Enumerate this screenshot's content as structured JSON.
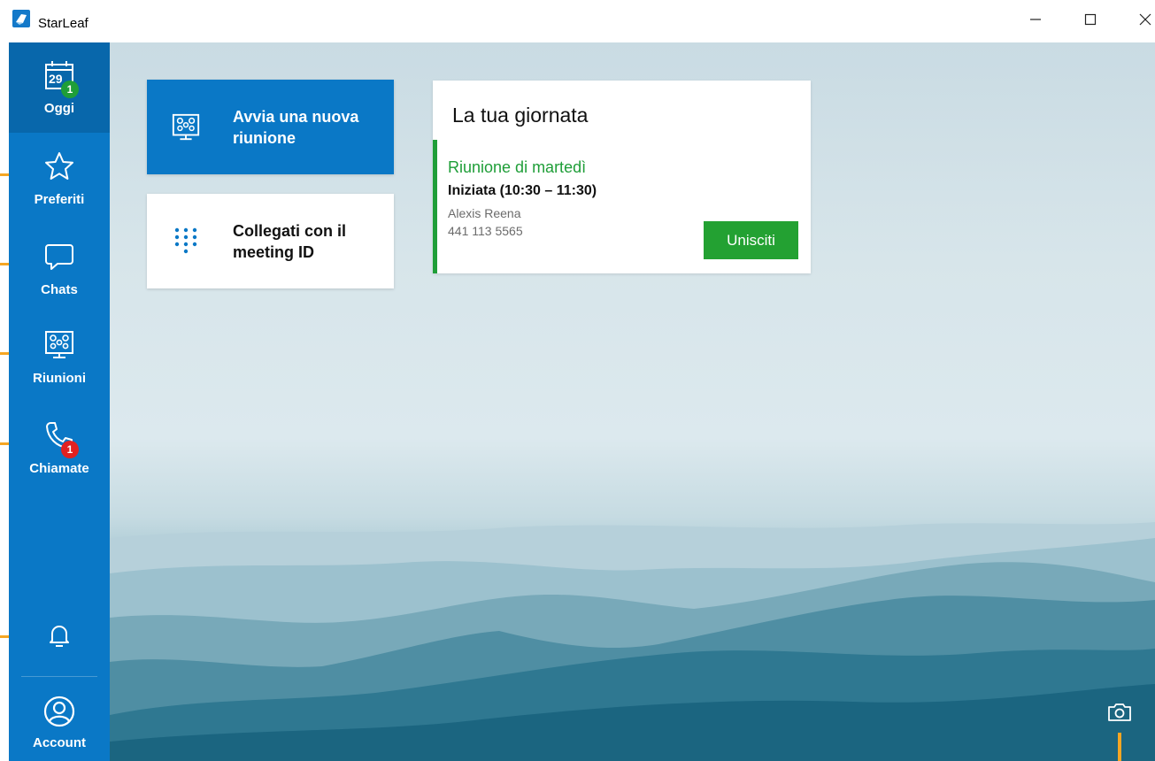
{
  "window": {
    "title": "StarLeaf",
    "minimize_icon": "minimize-icon",
    "maximize_icon": "maximize-icon",
    "close_icon": "close-icon"
  },
  "sidebar": {
    "items": [
      {
        "label": "Oggi",
        "icon": "calendar-icon",
        "calendar_day": "29",
        "badge": "1",
        "badge_color": "#1f9e38",
        "active": true
      },
      {
        "label": "Preferiti",
        "icon": "star-icon"
      },
      {
        "label": "Chats",
        "icon": "chat-bubble-icon"
      },
      {
        "label": "Riunioni",
        "icon": "meeting-room-icon"
      },
      {
        "label": "Chiamate",
        "icon": "phone-icon",
        "badge": "1",
        "badge_color": "#e22120"
      }
    ],
    "notifications_icon": "bell-icon",
    "account": {
      "label": "Account",
      "icon": "user-circle-icon"
    }
  },
  "tiles": {
    "new_meeting": "Avvia una nuova riunione",
    "join_meeting_id": "Collegati con il meeting ID"
  },
  "day_card": {
    "title": "La tua giornata",
    "meeting": {
      "name": "Riunione di martedì",
      "status": "Iniziata (10:30 – 11:30)",
      "host": "Alexis Reena",
      "number": "441 113 5565",
      "join_label": "Unisciti"
    }
  },
  "background": {
    "camera_icon": "camera-icon"
  },
  "colors": {
    "sidebar": "#0a78c6",
    "sidebar_active": "#0867ab",
    "accent_green": "#1f9e38",
    "join_button": "#23a132",
    "badge_red": "#e22120"
  }
}
